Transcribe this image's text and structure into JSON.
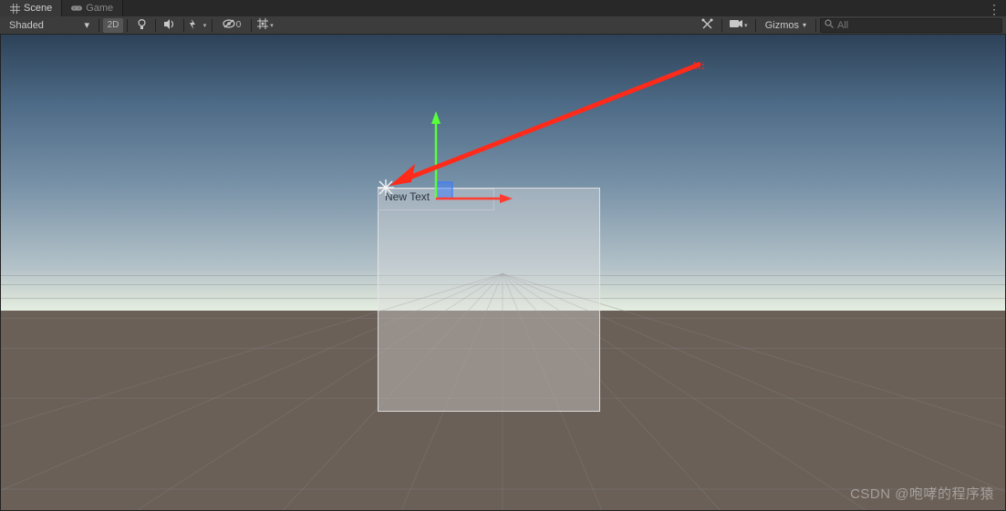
{
  "tabs": {
    "scene": "Scene",
    "game": "Game"
  },
  "toolbar": {
    "shading_mode": "Shaded",
    "mode_2d": "2D",
    "hidden_count": "0",
    "gizmos_label": "Gizmos",
    "search_placeholder": "All"
  },
  "scene": {
    "text_element_label": "New Text"
  },
  "watermark": "CSDN @咆哮的程序猿",
  "colors": {
    "x_axis": "#ff3b30",
    "y_axis": "#58ff3a",
    "z_axis": "#3d7dff",
    "annotation": "#ff2a1a"
  }
}
